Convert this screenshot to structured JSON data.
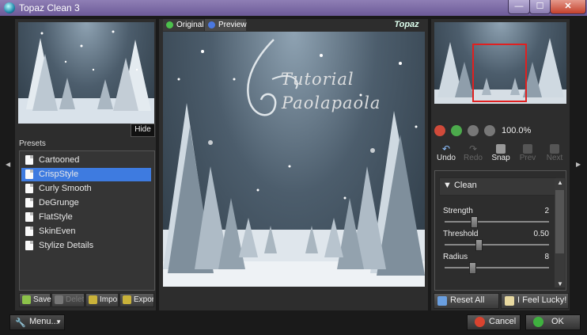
{
  "window": {
    "title": "Topaz Clean 3",
    "min_label": "—",
    "max_label": "☐",
    "close_label": "✕"
  },
  "left_panel": {
    "hide_label": "Hide",
    "presets_label": "Presets",
    "presets": [
      {
        "label": "Cartooned",
        "selected": false
      },
      {
        "label": "CrispStyle",
        "selected": true
      },
      {
        "label": "Curly Smooth",
        "selected": false
      },
      {
        "label": "DeGrunge",
        "selected": false
      },
      {
        "label": "FlatStyle",
        "selected": false
      },
      {
        "label": "SkinEven",
        "selected": false
      },
      {
        "label": "Stylize Details",
        "selected": false
      }
    ],
    "buttons": {
      "save": "Save",
      "delete": "Delete",
      "import": "Import",
      "export": "Export"
    }
  },
  "center": {
    "tab_original": "Original",
    "tab_preview": "Preview",
    "brand": "Topaz",
    "watermark_line1": "Tutorial",
    "watermark_line2": "Paolapaola"
  },
  "right_panel": {
    "zoom_level": "100.0%",
    "tools": {
      "undo": "Undo",
      "redo": "Redo",
      "snap": "Snap",
      "prev": "Prev",
      "next": "Next"
    },
    "section_title": "Clean",
    "params": [
      {
        "label": "Strength",
        "value": "2",
        "fraction": 0.05
      },
      {
        "label": "Threshold",
        "value": "0.50",
        "fraction": 0.12
      },
      {
        "label": "Radius",
        "value": "8",
        "fraction": 0.03
      }
    ],
    "reset_label": "Reset All",
    "lucky_label": "I Feel Lucky!"
  },
  "bottom": {
    "menu_label": "Menu...",
    "cancel_label": "Cancel",
    "ok_label": "OK"
  },
  "colors": {
    "selection": "#3e7be0",
    "panel": "#2d2d2d",
    "frame": "#1a1a1a",
    "viewport_rect": "#e02020"
  }
}
